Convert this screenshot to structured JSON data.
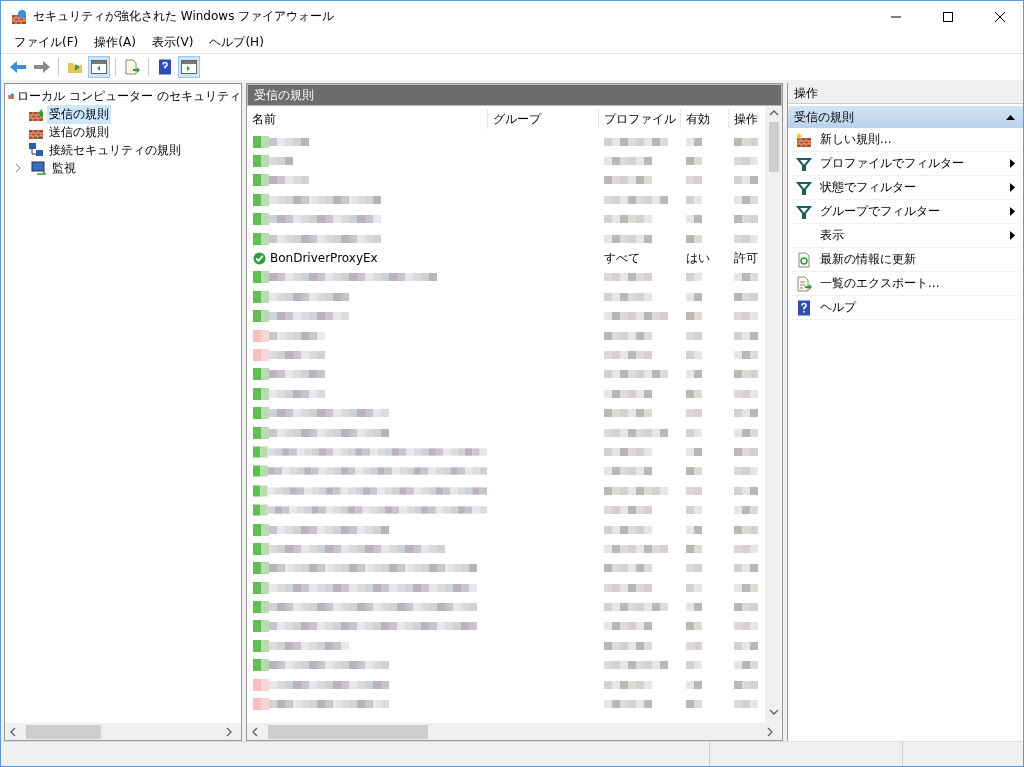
{
  "window": {
    "title": "セキュリティが強化された Windows ファイアウォール"
  },
  "menu": [
    "ファイル(F)",
    "操作(A)",
    "表示(V)",
    "ヘルプ(H)"
  ],
  "tree": {
    "label": "ローカル コンピューター のセキュリティ",
    "children": [
      {
        "label": "受信の規則",
        "selected": true,
        "kind": "inbound",
        "expandable": false
      },
      {
        "label": "送信の規則",
        "selected": false,
        "kind": "outbound",
        "expandable": false
      },
      {
        "label": "接続セキュリティの規則",
        "selected": false,
        "kind": "connection",
        "expandable": false
      },
      {
        "label": "監視",
        "selected": false,
        "kind": "monitor",
        "expandable": true
      }
    ]
  },
  "center": {
    "title": "受信の規則",
    "columns": [
      "名前",
      "グループ",
      "プロファイル",
      "有効",
      "操作"
    ],
    "rows": [
      {
        "kind": "redacted",
        "blocked": false
      },
      {
        "kind": "redacted",
        "blocked": false
      },
      {
        "kind": "redacted",
        "blocked": false
      },
      {
        "kind": "redacted",
        "blocked": false
      },
      {
        "kind": "redacted",
        "blocked": false
      },
      {
        "kind": "redacted",
        "blocked": false
      },
      {
        "kind": "rule",
        "name": "BonDriverProxyEx",
        "profile": "すべて",
        "enabled": "はい",
        "action": "許可"
      },
      {
        "kind": "redacted",
        "blocked": false
      },
      {
        "kind": "redacted",
        "blocked": false
      },
      {
        "kind": "redacted",
        "blocked": false
      },
      {
        "kind": "redacted",
        "blocked": true
      },
      {
        "kind": "redacted",
        "blocked": true
      },
      {
        "kind": "redacted",
        "blocked": false
      },
      {
        "kind": "redacted",
        "blocked": false
      },
      {
        "kind": "redacted",
        "blocked": false
      },
      {
        "kind": "redacted",
        "blocked": false
      },
      {
        "kind": "redacted",
        "blocked": false
      },
      {
        "kind": "redacted",
        "blocked": false
      },
      {
        "kind": "redacted",
        "blocked": false
      },
      {
        "kind": "redacted",
        "blocked": false
      },
      {
        "kind": "redacted",
        "blocked": false
      },
      {
        "kind": "redacted",
        "blocked": false
      },
      {
        "kind": "redacted",
        "blocked": false
      },
      {
        "kind": "redacted",
        "blocked": false
      },
      {
        "kind": "redacted",
        "blocked": false
      },
      {
        "kind": "redacted",
        "blocked": false
      },
      {
        "kind": "redacted",
        "blocked": false
      },
      {
        "kind": "redacted",
        "blocked": false
      },
      {
        "kind": "redacted",
        "blocked": true
      },
      {
        "kind": "redacted",
        "blocked": true
      }
    ]
  },
  "actions": {
    "title": "操作",
    "section": "受信の規則",
    "items": [
      {
        "label": "新しい規則...",
        "kind": "new",
        "submenu": false
      },
      {
        "label": "プロファイルでフィルター",
        "kind": "filter",
        "submenu": true
      },
      {
        "label": "状態でフィルター",
        "kind": "filter",
        "submenu": true
      },
      {
        "label": "グループでフィルター",
        "kind": "filter",
        "submenu": true
      },
      {
        "label": "表示",
        "kind": "plain",
        "submenu": true
      },
      {
        "label": "最新の情報に更新",
        "kind": "refresh",
        "submenu": false
      },
      {
        "label": "一覧のエクスポート...",
        "kind": "export",
        "submenu": false
      },
      {
        "label": "ヘルプ",
        "kind": "help",
        "submenu": false
      }
    ]
  }
}
